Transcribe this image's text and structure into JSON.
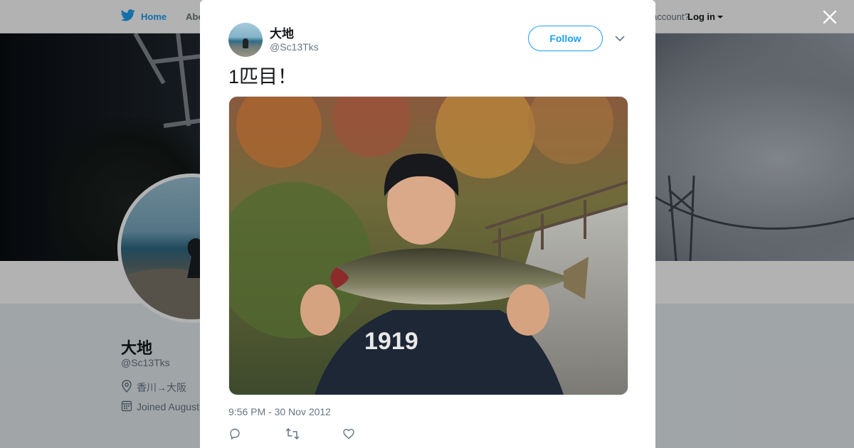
{
  "nav": {
    "home_label": "Home",
    "about_label": "Abo",
    "account_prompt": "account?",
    "login_label": "Log in"
  },
  "profile_bg": {
    "name": "大地",
    "handle": "@Sc13Tks",
    "location": "香川→大阪",
    "joined": "Joined August"
  },
  "tweet": {
    "author_name": "大地",
    "author_handle": "@Sc13Tks",
    "follow_label": "Follow",
    "text": "1匹目！",
    "timestamp": "9:56 PM - 30 Nov 2012",
    "actions": [
      "reply-icon",
      "retweet-icon",
      "like-icon"
    ]
  },
  "colors": {
    "accent": "#1da1f2",
    "text_primary": "#14171a",
    "text_secondary": "#657786"
  },
  "icons": {
    "brand": "bird-icon",
    "close": "close-icon",
    "more": "chevron-down-icon",
    "location": "location-pin-icon",
    "joined": "calendar-icon"
  }
}
